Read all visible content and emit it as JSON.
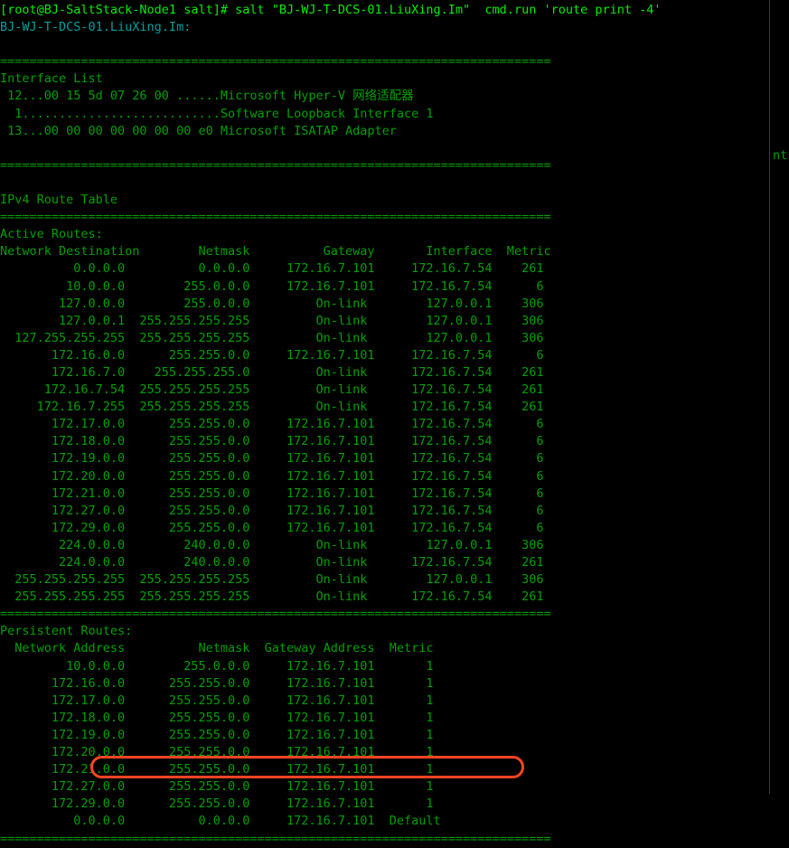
{
  "terminal": {
    "prompt_line": "[root@BJ-SaltStack-Node1 salt]# salt \"BJ-WJ-T-DCS-01.LiuXing.Im\"  cmd.run 'route print -4'",
    "target_host": "BJ-WJ-T-DCS-01.LiuXing.Im:",
    "separator_top": "===========================================================================",
    "separator_mid": "===========================================================================",
    "separator_persistent": "===========================================================================",
    "separator_bottom": "===========================================================================",
    "interface_list_heading": "Interface List",
    "interface_lines": [
      " 12...00 15 5d 07 26 00 ......Microsoft Hyper-V 网络适配器",
      "  1...........................Software Loopback Interface 1",
      " 13...00 00 00 00 00 00 00 e0 Microsoft ISATAP Adapter"
    ],
    "ipv4_heading": "IPv4 Route Table",
    "active_routes_label": "Active Routes:",
    "active_header": "Network Destination        Netmask          Gateway       Interface  Metric",
    "active_rows": [
      "          0.0.0.0          0.0.0.0     172.16.7.101     172.16.7.54    261",
      "         10.0.0.0        255.0.0.0     172.16.7.101     172.16.7.54      6",
      "        127.0.0.0        255.0.0.0         On-link        127.0.0.1    306",
      "        127.0.0.1  255.255.255.255         On-link        127.0.0.1    306",
      "  127.255.255.255  255.255.255.255         On-link        127.0.0.1    306",
      "       172.16.0.0      255.255.0.0     172.16.7.101     172.16.7.54      6",
      "       172.16.7.0    255.255.255.0         On-link      172.16.7.54    261",
      "      172.16.7.54  255.255.255.255         On-link      172.16.7.54    261",
      "     172.16.7.255  255.255.255.255         On-link      172.16.7.54    261",
      "       172.17.0.0      255.255.0.0     172.16.7.101     172.16.7.54      6",
      "       172.18.0.0      255.255.0.0     172.16.7.101     172.16.7.54      6",
      "       172.19.0.0      255.255.0.0     172.16.7.101     172.16.7.54      6",
      "       172.20.0.0      255.255.0.0     172.16.7.101     172.16.7.54      6",
      "       172.21.0.0      255.255.0.0     172.16.7.101     172.16.7.54      6",
      "       172.27.0.0      255.255.0.0     172.16.7.101     172.16.7.54      6",
      "       172.29.0.0      255.255.0.0     172.16.7.101     172.16.7.54      6",
      "        224.0.0.0        240.0.0.0         On-link        127.0.0.1    306",
      "        224.0.0.0        240.0.0.0         On-link      172.16.7.54    261",
      "  255.255.255.255  255.255.255.255         On-link        127.0.0.1    306",
      "  255.255.255.255  255.255.255.255         On-link      172.16.7.54    261"
    ],
    "persistent_routes_label": "Persistent Routes:",
    "persistent_header": "  Network Address          Netmask  Gateway Address  Metric",
    "persistent_rows": [
      "         10.0.0.0        255.0.0.0     172.16.7.101       1",
      "       172.16.0.0      255.255.0.0     172.16.7.101       1",
      "       172.17.0.0      255.255.0.0     172.16.7.101       1",
      "       172.18.0.0      255.255.0.0     172.16.7.101       1",
      "       172.19.0.0      255.255.0.0     172.16.7.101       1",
      "       172.20.0.0      255.255.0.0     172.16.7.101       1",
      "       172.21.0.0      255.255.0.0     172.16.7.101       1",
      "       172.27.0.0      255.255.0.0     172.16.7.101       1",
      "       172.29.0.0      255.255.0.0     172.16.7.101       1"
    ],
    "persistent_default_row": "          0.0.0.0          0.0.0.0     172.16.7.101  Default",
    "background_window_text": "nt -",
    "colors": {
      "background": "#000000",
      "prompt_green": "#00ee00",
      "output_green": "#00a000",
      "host_cyan": "#00a0a0",
      "highlight_red": "#ff4422",
      "window_border": "#3a3a3a"
    }
  }
}
